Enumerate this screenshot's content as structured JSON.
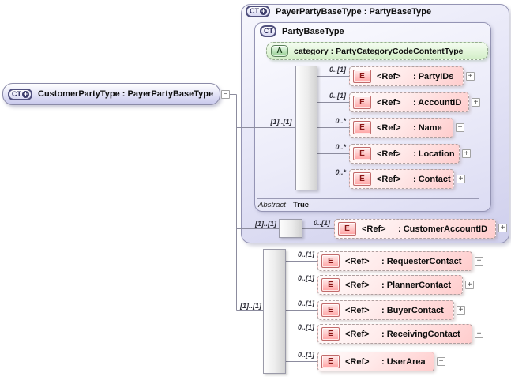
{
  "root": {
    "icon_text": "CT",
    "plus_badge": "+",
    "label": "CustomerPartyType : PayerPartyBaseType"
  },
  "collapse_glyph": "−",
  "payer": {
    "icon_text": "CT",
    "plus_badge": "+",
    "title": "PayerPartyBaseType : PartyBaseType",
    "party": {
      "icon_text": "CT",
      "title": "PartyBaseType",
      "attr": {
        "icon_text": "A",
        "label": "category : PartyCategoryCodeContentType"
      },
      "seq_card": "[1]..[1]",
      "elements": [
        {
          "card": "0..[1]",
          "icon_text": "E",
          "name": "<Ref>",
          "type": ": PartyIDs",
          "expand": "+"
        },
        {
          "card": "0..[1]",
          "icon_text": "E",
          "name": "<Ref>",
          "type": ": AccountID",
          "expand": "+"
        },
        {
          "card": "0..*",
          "icon_text": "E",
          "name": "<Ref>",
          "type": ": Name",
          "expand": "+"
        },
        {
          "card": "0..*",
          "icon_text": "E",
          "name": "<Ref>",
          "type": ": Location",
          "expand": "+"
        },
        {
          "card": "0..*",
          "icon_text": "E",
          "name": "<Ref>",
          "type": ": Contact",
          "expand": "+"
        }
      ],
      "footer": {
        "label": "Abstract",
        "value": "True"
      }
    },
    "account": {
      "seq_card": "[1]..[1]",
      "card": "0..[1]",
      "icon_text": "E",
      "name": "<Ref>",
      "type": ": CustomerAccountID",
      "expand": "+"
    }
  },
  "contacts": {
    "seq_card": "[1]..[1]",
    "elements": [
      {
        "card": "0..[1]",
        "icon_text": "E",
        "name": "<Ref>",
        "type": ": RequesterContact",
        "expand": "+"
      },
      {
        "card": "0..[1]",
        "icon_text": "E",
        "name": "<Ref>",
        "type": ": PlannerContact",
        "expand": "+"
      },
      {
        "card": "0..[1]",
        "icon_text": "E",
        "name": "<Ref>",
        "type": ": BuyerContact",
        "expand": "+"
      },
      {
        "card": "0..[1]",
        "icon_text": "E",
        "name": "<Ref>",
        "type": ": ReceivingContact",
        "expand": "+"
      },
      {
        "card": "0..[1]",
        "icon_text": "E",
        "name": "<Ref>",
        "type": ": UserArea",
        "expand": "+"
      }
    ]
  },
  "colors": {
    "container_fill": "#dcdcf4",
    "container_border": "#9494b4",
    "attribute_fill": "#d9f0d0",
    "element_fill": "#ffd0d0",
    "element_icon_border": "#c26a6a",
    "connector_line": "#8c8c9e"
  }
}
